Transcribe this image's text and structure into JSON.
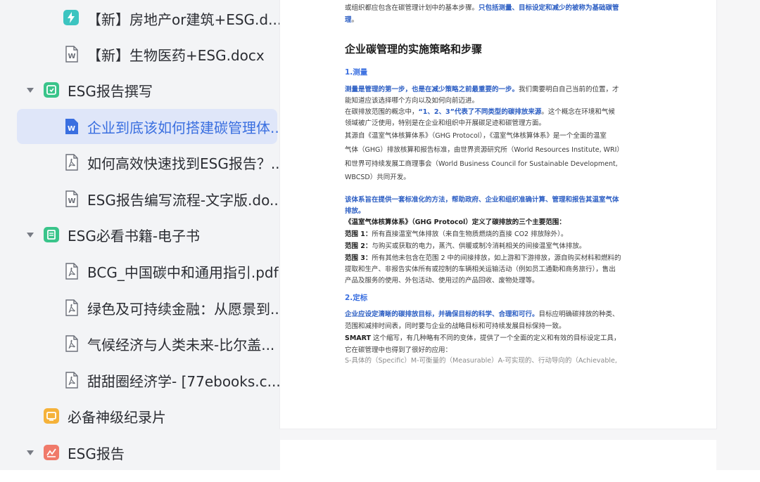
{
  "sidebar": {
    "items": [
      {
        "label": "【新】房地产or建筑+ESG.d...",
        "icon": "lightning-app-icon"
      },
      {
        "label": "【新】生物医药+ESG.docx",
        "icon": "word-doc-icon"
      },
      {
        "label": "ESG报告撰写",
        "icon": "green-folder-icon"
      },
      {
        "label": "企业到底该如何搭建碳管理体...",
        "icon": "word-doc-icon"
      },
      {
        "label": "如何高效快速找到ESG报告？...",
        "icon": "pdf-icon"
      },
      {
        "label": "ESG报告编写流程-文字版.do...",
        "icon": "word-doc-icon"
      },
      {
        "label": "ESG必看书籍-电子书",
        "icon": "green-folder-icon"
      },
      {
        "label": "BCG_中国碳中和通用指引.pdf",
        "icon": "pdf-icon"
      },
      {
        "label": "绿色及可持续金融：从愿景到...",
        "icon": "pdf-icon"
      },
      {
        "label": "气候经济与人类未来-比尔盖...",
        "icon": "pdf-icon"
      },
      {
        "label": "甜甜圈经济学- [77ebooks.c...",
        "icon": "pdf-icon"
      },
      {
        "label": "必备神级纪录片",
        "icon": "orange-folder-icon"
      },
      {
        "label": "ESG报告",
        "icon": "red-folder-icon"
      }
    ]
  },
  "document": {
    "intro_line1": "或组织都应包含在碳管理计划中的基本步骤。",
    "intro_line1_bold": "只包括测量、目标设定和减少的被称为基础碳管",
    "intro_line2_bold": "理",
    "intro_line2": "。",
    "heading": "企业碳管理的实施策略和步骤",
    "section1": "1.测量",
    "s1_p1_bold": "测量是管理的第一步，也是在减少策略之前最重要的一步。",
    "s1_p1": "我们需要明白自己当前的位置，才",
    "s1_p2": "能知道应该选择哪个方向以及如何向前迈进。",
    "s1_p3a": "在碳排放范围的概念中，",
    "s1_p3b": "“1、2、3”代表了不同类型的碳排放来源",
    "s1_p3c": "。这个概念在环境和气候",
    "s1_p4": "领域被广泛使用，特别是在企业和组织中开展碳足迹和碳管理方面。",
    "s1_p5": "其源自《温室气体核算体系》（GHG Protocol），《温室气体核算体系》是一个全面的温室",
    "s1_p6": "气体（GHG）排放核算和报告标准，由世界资源研究所（World Resources Institute, WRI）",
    "s1_p7": "和世界可持续发展工商理事会（World Business Council for Sustainable Development,",
    "s1_p8": "WBCSD）共同开发。",
    "s1_p9": "该体系旨在提供一套标准化的方法，帮助政府、企业和组织准确计算、管理和报告其温室气体",
    "s1_p10": "排放。",
    "s1_p11": "《温室气体核算体系》（GHG Protocol）定义了碳排放的三个主要范围：",
    "scope1_label": "范围 1：",
    "scope1": "所有直接温室气体排放（来自生物质燃烧的直接 CO2 排放除外）。",
    "scope2_label": "范围 2：",
    "scope2": "与购买或获取的电力，蒸汽、供暖或制冷消耗相关的间接温室气体排放。",
    "scope3_label": "范围 3：",
    "scope3a": "所有其他未包含在范围 2 中的间接排放，如上游和下游排放，源自购买材料和燃料的",
    "scope3b": "提取和生产、非报告实体所有或控制的车辆相关运输活动（例如员工通勤和商务旅行），售出",
    "scope3c": "产品及服务的使用、外包活动、使用过的产品回收、废物处理等。",
    "section2": "2.定标",
    "s2_p1_bold": "企业应设定清晰的碳排放目标，并确保目标的科学、合理和可行。",
    "s2_p1": "目标应明确碳排放的种类、",
    "s2_p2": "范围和减排时间表，同时要与企业的战略目标和可持续发展目标保持一致。",
    "s2_p3_bold": "SMART",
    "s2_p3": " 这个缩写，有几种略有不同的变体，提供了一个全面的定义和有效的目标设定工具，",
    "s2_p4": "它在碳管理中也得到了很好的应用：",
    "s2_p5": "S-具体的（Specific）M-可衡量的（Measurable）A-可实现的、行动导向的（Achievable,"
  },
  "colors": {
    "accent": "#3a6fe0",
    "sidebar_bg": "#f3f4f6",
    "active_bg": "#dfe6f9"
  }
}
